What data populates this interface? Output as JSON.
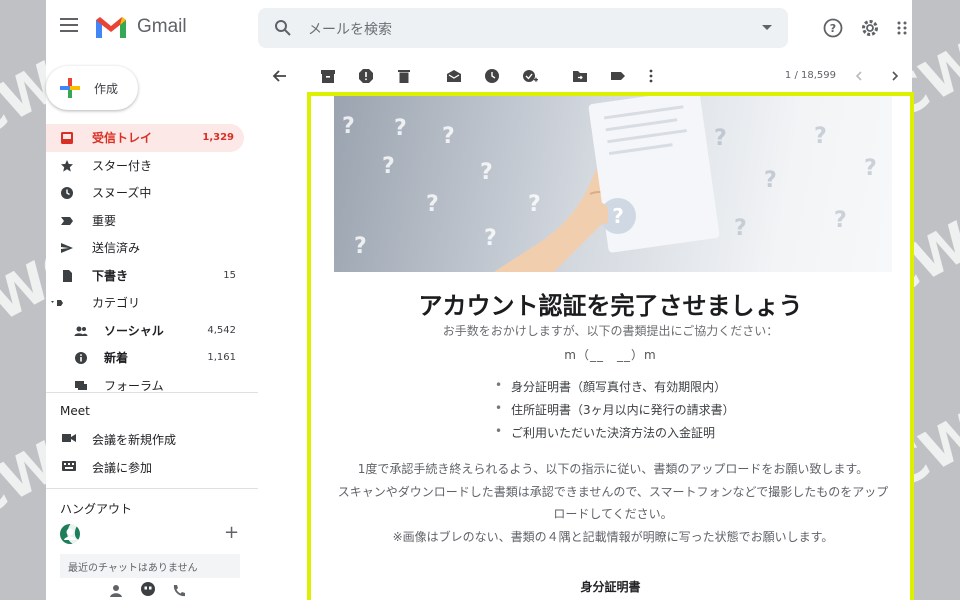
{
  "app": {
    "name": "Gmail"
  },
  "search": {
    "placeholder": "メールを検索"
  },
  "compose": {
    "label": "作成"
  },
  "nav": [
    {
      "label": "受信トレイ",
      "count": "1,329",
      "icon": "inbox-icon",
      "active": true
    },
    {
      "label": "スター付き",
      "count": "",
      "icon": "star-icon"
    },
    {
      "label": "スヌーズ中",
      "count": "",
      "icon": "clock-icon"
    },
    {
      "label": "重要",
      "count": "",
      "icon": "important-icon"
    },
    {
      "label": "送信済み",
      "count": "",
      "icon": "send-icon"
    },
    {
      "label": "下書き",
      "count": "15",
      "icon": "draft-icon",
      "bold": true
    },
    {
      "label": "カテゴリ",
      "count": "",
      "icon": "label-icon"
    },
    {
      "label": "ソーシャル",
      "count": "4,542",
      "icon": "people-icon",
      "sub": true,
      "bold": true
    },
    {
      "label": "新着",
      "count": "1,161",
      "icon": "info-icon",
      "sub": true,
      "bold": true
    },
    {
      "label": "フォーラム",
      "count": "",
      "icon": "forum-icon",
      "sub": true
    }
  ],
  "meet": {
    "title": "Meet",
    "items": [
      {
        "label": "会議を新規作成",
        "icon": "video-icon"
      },
      {
        "label": "会議に参加",
        "icon": "keyboard-icon"
      }
    ]
  },
  "hangouts": {
    "title": "ハングアウト",
    "notice": "最近のチャットはありません"
  },
  "toolbar": {
    "pager": "1 / 18,599"
  },
  "email": {
    "title": "アカウント認証を完了させましょう",
    "subtitle": "お手数をおかけしますが、以下の書類提出にご協力ください：",
    "mm": "m（__　__）m",
    "documents": [
      "身分証明書（顔写真付き、有効期限内）",
      "住所証明書（3ヶ月以内に発行の請求書）",
      "ご利用いただいた決済方法の入金証明"
    ],
    "body": [
      "1度で承認手続き終えられるよう、以下の指示に従い、書類のアップロードをお願い致します。",
      "スキャンやダウンロードした書類は承認できませんので、スマートフォンなどで撮影したものをアップロードしてください。",
      "※画像はブレのない、書類の４隅と記載情報が明瞭に写った状態でお願いします。"
    ],
    "section_title": "身分証明書"
  },
  "watermark": {
    "text": "CWC"
  },
  "colors": {
    "highlight": "#dcf000",
    "inbox_red": "#d93025",
    "active_bg": "#fce8e6"
  }
}
